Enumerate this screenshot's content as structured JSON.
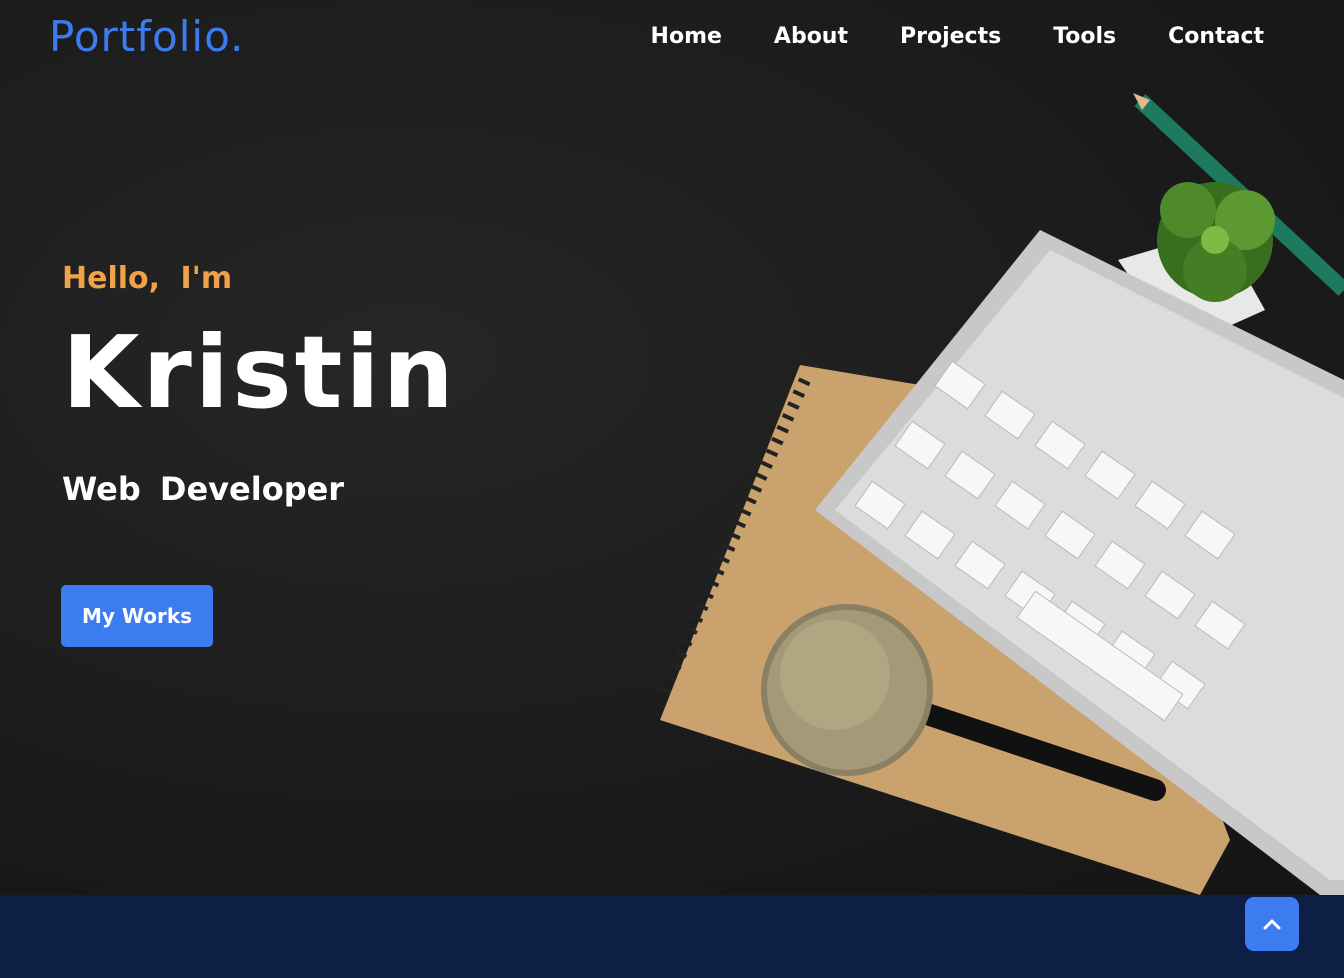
{
  "brand": {
    "logo": "Portfolio."
  },
  "nav": {
    "items": [
      "Home",
      "About",
      "Projects",
      "Tools",
      "Contact"
    ]
  },
  "hero": {
    "greeting": "Hello,  I'm",
    "name": "Kristin",
    "role": "Web  Developer",
    "cta_label": "My Works"
  },
  "colors": {
    "accent": "#3d7bf0",
    "greeting": "#f0a24a",
    "footer": "#0d1f44"
  },
  "icons": {
    "scroll_top": "chevron-up-icon"
  }
}
